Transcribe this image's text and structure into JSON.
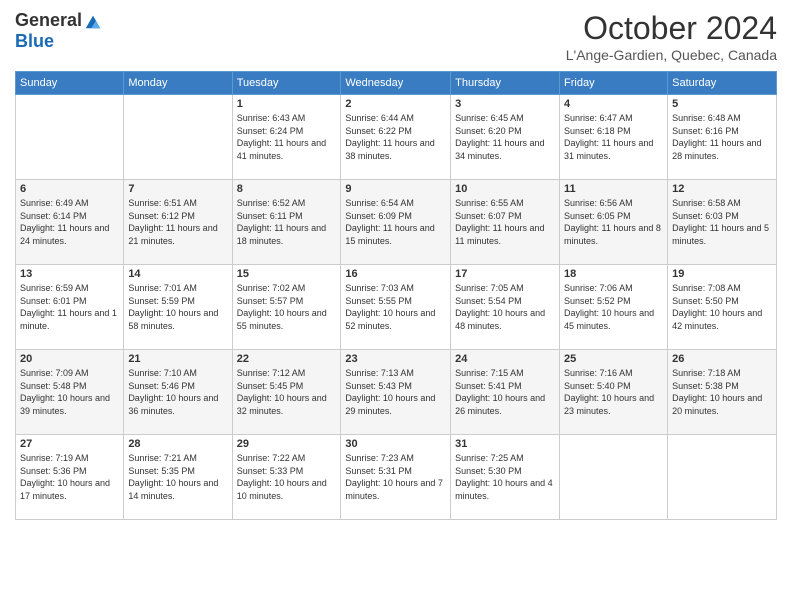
{
  "header": {
    "logo_general": "General",
    "logo_blue": "Blue",
    "month_title": "October 2024",
    "location": "L'Ange-Gardien, Quebec, Canada"
  },
  "days_of_week": [
    "Sunday",
    "Monday",
    "Tuesday",
    "Wednesday",
    "Thursday",
    "Friday",
    "Saturday"
  ],
  "weeks": [
    [
      {
        "day": "",
        "info": ""
      },
      {
        "day": "",
        "info": ""
      },
      {
        "day": "1",
        "info": "Sunrise: 6:43 AM\nSunset: 6:24 PM\nDaylight: 11 hours and 41 minutes."
      },
      {
        "day": "2",
        "info": "Sunrise: 6:44 AM\nSunset: 6:22 PM\nDaylight: 11 hours and 38 minutes."
      },
      {
        "day": "3",
        "info": "Sunrise: 6:45 AM\nSunset: 6:20 PM\nDaylight: 11 hours and 34 minutes."
      },
      {
        "day": "4",
        "info": "Sunrise: 6:47 AM\nSunset: 6:18 PM\nDaylight: 11 hours and 31 minutes."
      },
      {
        "day": "5",
        "info": "Sunrise: 6:48 AM\nSunset: 6:16 PM\nDaylight: 11 hours and 28 minutes."
      }
    ],
    [
      {
        "day": "6",
        "info": "Sunrise: 6:49 AM\nSunset: 6:14 PM\nDaylight: 11 hours and 24 minutes."
      },
      {
        "day": "7",
        "info": "Sunrise: 6:51 AM\nSunset: 6:12 PM\nDaylight: 11 hours and 21 minutes."
      },
      {
        "day": "8",
        "info": "Sunrise: 6:52 AM\nSunset: 6:11 PM\nDaylight: 11 hours and 18 minutes."
      },
      {
        "day": "9",
        "info": "Sunrise: 6:54 AM\nSunset: 6:09 PM\nDaylight: 11 hours and 15 minutes."
      },
      {
        "day": "10",
        "info": "Sunrise: 6:55 AM\nSunset: 6:07 PM\nDaylight: 11 hours and 11 minutes."
      },
      {
        "day": "11",
        "info": "Sunrise: 6:56 AM\nSunset: 6:05 PM\nDaylight: 11 hours and 8 minutes."
      },
      {
        "day": "12",
        "info": "Sunrise: 6:58 AM\nSunset: 6:03 PM\nDaylight: 11 hours and 5 minutes."
      }
    ],
    [
      {
        "day": "13",
        "info": "Sunrise: 6:59 AM\nSunset: 6:01 PM\nDaylight: 11 hours and 1 minute."
      },
      {
        "day": "14",
        "info": "Sunrise: 7:01 AM\nSunset: 5:59 PM\nDaylight: 10 hours and 58 minutes."
      },
      {
        "day": "15",
        "info": "Sunrise: 7:02 AM\nSunset: 5:57 PM\nDaylight: 10 hours and 55 minutes."
      },
      {
        "day": "16",
        "info": "Sunrise: 7:03 AM\nSunset: 5:55 PM\nDaylight: 10 hours and 52 minutes."
      },
      {
        "day": "17",
        "info": "Sunrise: 7:05 AM\nSunset: 5:54 PM\nDaylight: 10 hours and 48 minutes."
      },
      {
        "day": "18",
        "info": "Sunrise: 7:06 AM\nSunset: 5:52 PM\nDaylight: 10 hours and 45 minutes."
      },
      {
        "day": "19",
        "info": "Sunrise: 7:08 AM\nSunset: 5:50 PM\nDaylight: 10 hours and 42 minutes."
      }
    ],
    [
      {
        "day": "20",
        "info": "Sunrise: 7:09 AM\nSunset: 5:48 PM\nDaylight: 10 hours and 39 minutes."
      },
      {
        "day": "21",
        "info": "Sunrise: 7:10 AM\nSunset: 5:46 PM\nDaylight: 10 hours and 36 minutes."
      },
      {
        "day": "22",
        "info": "Sunrise: 7:12 AM\nSunset: 5:45 PM\nDaylight: 10 hours and 32 minutes."
      },
      {
        "day": "23",
        "info": "Sunrise: 7:13 AM\nSunset: 5:43 PM\nDaylight: 10 hours and 29 minutes."
      },
      {
        "day": "24",
        "info": "Sunrise: 7:15 AM\nSunset: 5:41 PM\nDaylight: 10 hours and 26 minutes."
      },
      {
        "day": "25",
        "info": "Sunrise: 7:16 AM\nSunset: 5:40 PM\nDaylight: 10 hours and 23 minutes."
      },
      {
        "day": "26",
        "info": "Sunrise: 7:18 AM\nSunset: 5:38 PM\nDaylight: 10 hours and 20 minutes."
      }
    ],
    [
      {
        "day": "27",
        "info": "Sunrise: 7:19 AM\nSunset: 5:36 PM\nDaylight: 10 hours and 17 minutes."
      },
      {
        "day": "28",
        "info": "Sunrise: 7:21 AM\nSunset: 5:35 PM\nDaylight: 10 hours and 14 minutes."
      },
      {
        "day": "29",
        "info": "Sunrise: 7:22 AM\nSunset: 5:33 PM\nDaylight: 10 hours and 10 minutes."
      },
      {
        "day": "30",
        "info": "Sunrise: 7:23 AM\nSunset: 5:31 PM\nDaylight: 10 hours and 7 minutes."
      },
      {
        "day": "31",
        "info": "Sunrise: 7:25 AM\nSunset: 5:30 PM\nDaylight: 10 hours and 4 minutes."
      },
      {
        "day": "",
        "info": ""
      },
      {
        "day": "",
        "info": ""
      }
    ]
  ]
}
